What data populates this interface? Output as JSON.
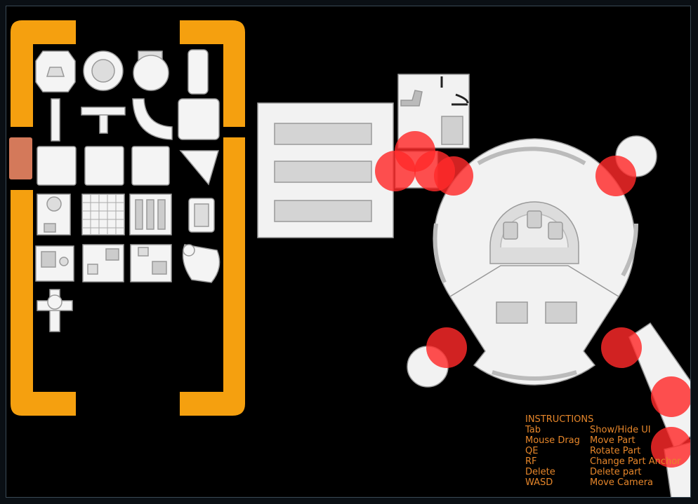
{
  "palette": {
    "panel_frame": "#f5a00f",
    "selected_tab": "#d4795a",
    "part_fill": "#f4f4f4",
    "part_stroke": "#9a9a9a",
    "anchor": "#ff2a2a",
    "instruction_text": "#e6862a",
    "background": "#000000"
  },
  "parts_palette": {
    "rows": [
      [
        "octagon-room-icon",
        "round-room-icon",
        "circle-room-icon",
        "capsule-room-icon"
      ],
      [
        "vertical-corridor-icon",
        "t-junction-icon",
        "curved-corridor-icon",
        "octagon-module-icon"
      ],
      [
        "square-module-icon",
        "square-module-icon",
        "square-module-icon",
        "triangle-module-icon"
      ],
      [
        "storage-room-icon",
        "grid-floor-icon",
        "shelves-room-icon",
        "seating-room-icon"
      ],
      [
        "bedroom-icon",
        "office-room-icon",
        "office-room-icon",
        "crescent-room-icon"
      ],
      [
        "cross-junction-icon"
      ]
    ]
  },
  "instructions": {
    "title": "INSTRUCTIONS",
    "rows": [
      {
        "key": "Tab",
        "action": "Show/Hide UI"
      },
      {
        "key": "Mouse Drag",
        "action": "Move Part"
      },
      {
        "key": "QE",
        "action": "Rotate Part"
      },
      {
        "key": "RF",
        "action": "Change Part Anchor"
      },
      {
        "key": "Delete",
        "action": "Delete part"
      },
      {
        "key": "WASD",
        "action": "Move Camera"
      }
    ]
  }
}
